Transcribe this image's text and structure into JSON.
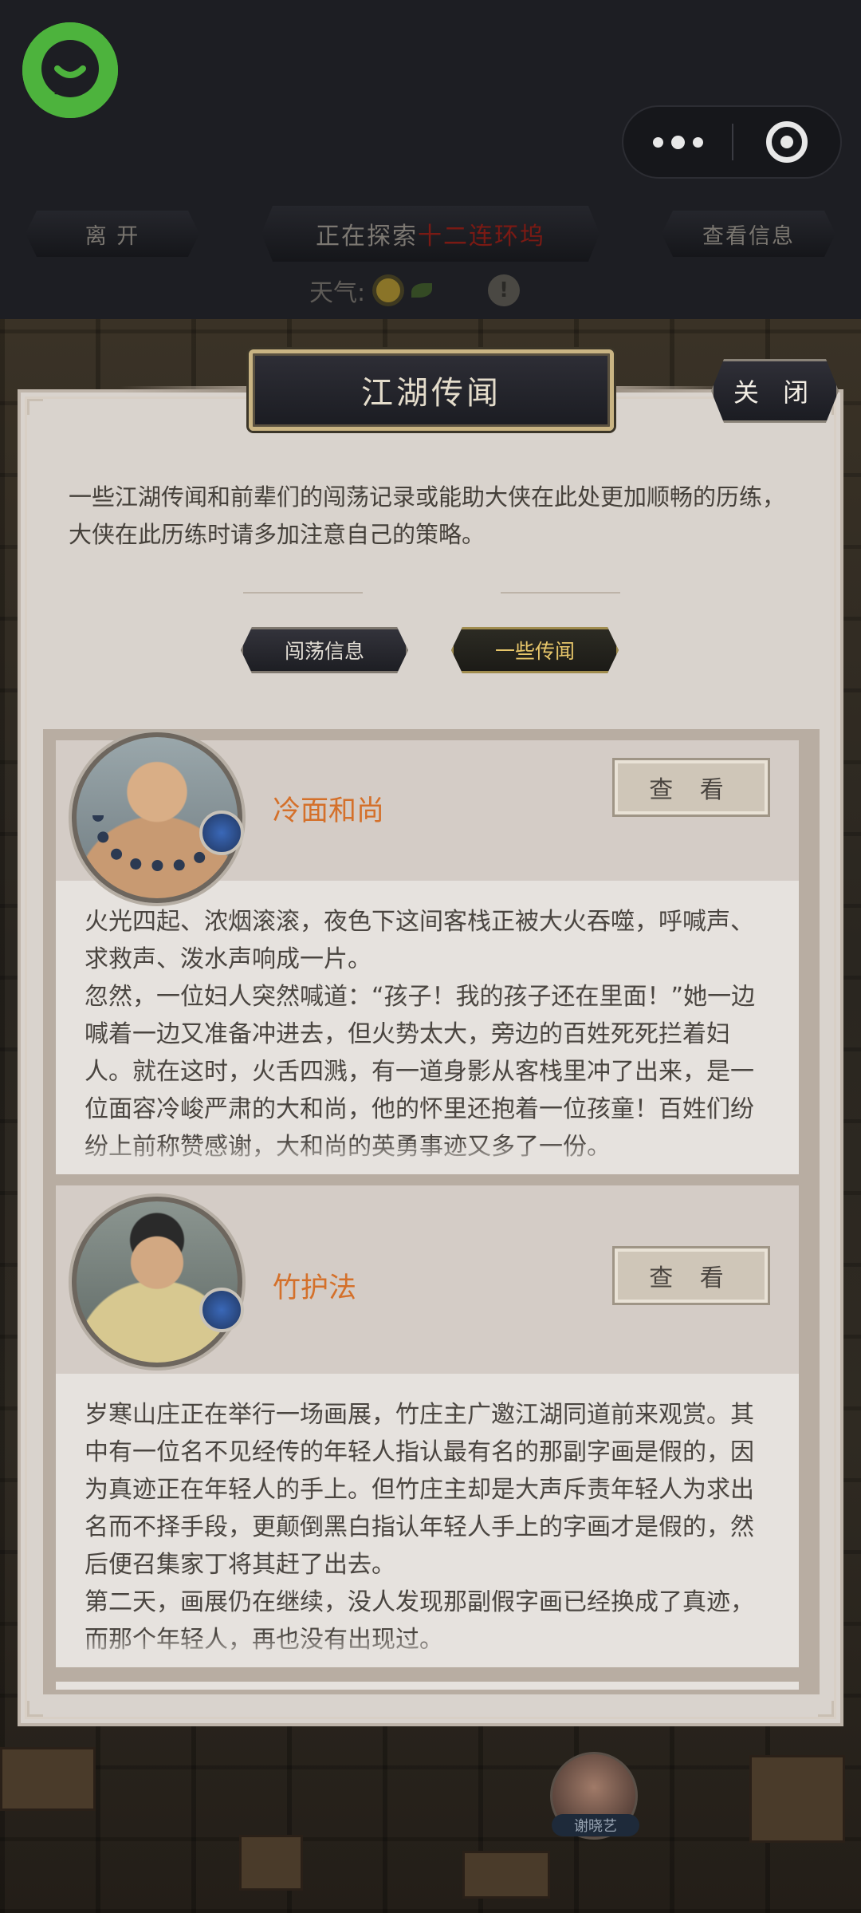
{
  "top_bar": {
    "leave_label": "离 开",
    "exploring_prefix": "正在探索",
    "exploring_location": "十二连环坞",
    "info_label": "查看信息",
    "weather_label": "天气:",
    "warn_glyph": "!"
  },
  "capsule": {
    "more_icon": "more-dots-icon",
    "close_icon": "target-circle-icon"
  },
  "panel": {
    "title": "江湖传闻",
    "close_label": "关 闭",
    "intro": "一些江湖传闻和前辈们的闯荡记录或能助大侠在此处更加顺畅的历练，大侠在此历练时请多加注意自己的策略。",
    "tabs": [
      {
        "label": "闯荡信息",
        "active": false
      },
      {
        "label": "一些传闻",
        "active": true
      }
    ]
  },
  "rumors": [
    {
      "name": "冷面和尚",
      "view_label": "查 看",
      "paragraphs": [
        "火光四起、浓烟滚滚，夜色下这间客栈正被大火吞噬，呼喊声、求救声、泼水声响成一片。",
        "忽然，一位妇人突然喊道：“孩子！我的孩子还在里面！”她一边喊着一边又准备冲进去，但火势太大，旁边的百姓死死拦着妇人。就在这时，火舌四溅，有一道身影从客栈里冲了出来，是一位面容冷峻严肃的大和尚，他的怀里还抱着一位孩童！百姓们纷纷上前称赞感谢，大和尚的英勇事迹又多了一份。"
      ]
    },
    {
      "name": "竹护法",
      "view_label": "查 看",
      "paragraphs": [
        "岁寒山庄正在举行一场画展，竹庄主广邀江湖同道前来观赏。其中有一位名不见经传的年轻人指认最有名的那副字画是假的，因为真迹正在年轻人的手上。但竹庄主却是大声斥责年轻人为求出名而不择手段，更颠倒黑白指认年轻人手上的字画才是假的，然后便召集家丁将其赶了出去。",
        "第二天，画展仍在继续，没人发现那副假字画已经换成了真迹，而那个年轻人，再也没有出现过。"
      ]
    }
  ],
  "npc": {
    "name": "谢晓艺"
  },
  "colors": {
    "accent_orange": "#d4702a",
    "location_red": "#7a1a14",
    "gold_tab": "#e7c66a",
    "logo_green": "#4db33d"
  }
}
